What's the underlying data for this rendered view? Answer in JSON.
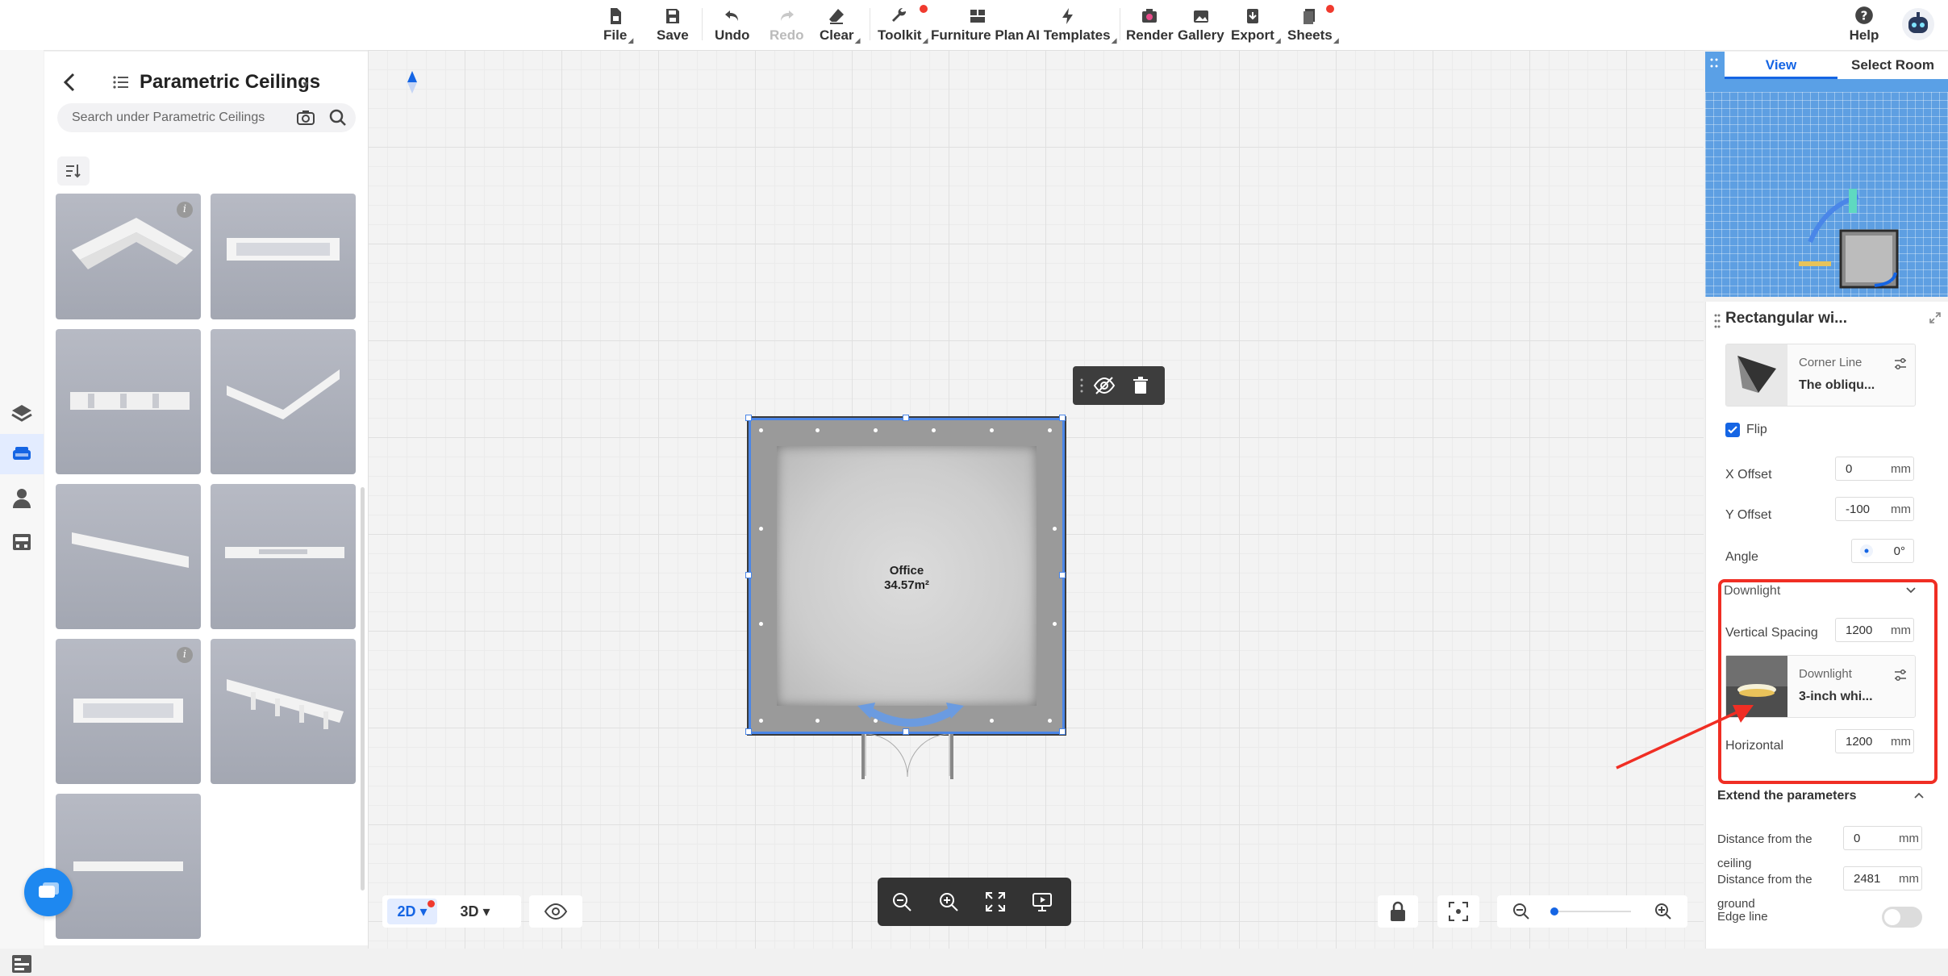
{
  "toolbar": {
    "file": "File",
    "save": "Save",
    "undo": "Undo",
    "redo": "Redo",
    "clear": "Clear",
    "toolkit": "Toolkit",
    "furniture_plan": "Furniture Plan",
    "ai_templates": "AI Templates",
    "render": "Render",
    "gallery": "Gallery",
    "export": "Export",
    "sheets": "Sheets",
    "help": "Help"
  },
  "library": {
    "title": "Parametric Ceilings",
    "search_placeholder": "Search under Parametric Ceilings",
    "tile_count": 9
  },
  "canvas": {
    "room_name": "Office",
    "room_area": "34.57m²",
    "view_2d": "2D",
    "view_3d": "3D"
  },
  "minimap": {
    "tab_view": "View",
    "tab_select_room": "Select Room"
  },
  "props": {
    "title": "Rectangular wi...",
    "corner_line": {
      "type": "Corner Line",
      "name": "The obliqu..."
    },
    "flip_label": "Flip",
    "x_offset": {
      "label": "X Offset",
      "value": "0",
      "unit": "mm"
    },
    "y_offset": {
      "label": "Y Offset",
      "value": "-100",
      "unit": "mm"
    },
    "angle": {
      "label": "Angle",
      "value": "0°"
    },
    "downlight_section": "Downlight",
    "vertical_spacing": {
      "label": "Vertical Spacing",
      "value": "1200",
      "unit": "mm"
    },
    "downlight_material": {
      "type": "Downlight",
      "name": "3-inch whi..."
    },
    "horizontal": {
      "label": "Horizontal",
      "value": "1200",
      "unit": "mm"
    },
    "extend_title": "Extend the parameters",
    "dist_ceiling": {
      "label_1": "Distance from the",
      "label_2": "ceiling",
      "value": "0",
      "unit": "mm"
    },
    "dist_ground": {
      "label_1": "Distance from the",
      "label_2": "ground",
      "value": "2481",
      "unit": "mm"
    },
    "edge_line": "Edge line"
  },
  "colors": {
    "accent": "#1565e4",
    "highlight": "#f02e24",
    "selection": "#4a86e8"
  }
}
